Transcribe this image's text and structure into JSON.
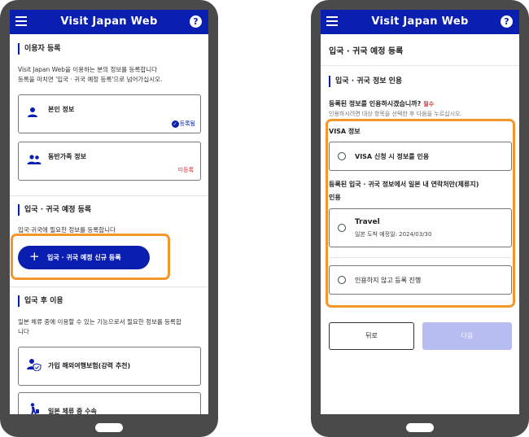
{
  "app": {
    "title": "Visit Japan Web",
    "help": "?"
  },
  "left": {
    "user_section": {
      "title": "이용자 등록",
      "desc_line1": "Visit Japan Web을 이용하는 분의 정보를 등록합니다",
      "desc_line2": "등록을 마치면 '입국 · 귀국 예정 등록'으로 넘어가십시오.",
      "card_self": {
        "label": "본인 정보",
        "status": "등록됨"
      },
      "card_family": {
        "label": "동반가족 정보",
        "status": "미등록"
      }
    },
    "entry_section": {
      "title": "입국 · 귀국 예정 등록",
      "desc": "입국·귀국에 필요한 정보를 등록합니다",
      "button": "입국 · 귀국 예정 신규 등록",
      "button_icon": "+"
    },
    "after_section": {
      "title": "입국 후 이용",
      "desc_line1": "일본 체류 중에 이용할 수 있는 기능으로서 필요한 정보를 등록합",
      "desc_line2": "니다",
      "card_insurance": {
        "label": "가입 해외여행보험(강력 추천)"
      },
      "card_stay": {
        "label": "일본 체류 중 수속"
      }
    }
  },
  "right": {
    "page_title": "입국 · 귀국 예정 등록",
    "section_title": "입국 · 귀국 정보 인용",
    "question": "등록된 정보를 인용하시겠습니까?",
    "required": "필수",
    "question_sub": "인용하시려면 대상 항목을 선택한 후 다음을 누르십시오.",
    "visa_heading": "VISA 정보",
    "visa_option": "VISA 신청 시 정보를 인용",
    "contact_heading_line1": "등록된 입국 · 귀국 정보에서 일본 내 연락처만(체류지)",
    "contact_heading_line2": "인용",
    "travel_option": {
      "title": "Travel",
      "sub": "일본 도착 예정일: 2024/03/30"
    },
    "no_cite_option": "인용하지 않고 등록 진행",
    "back_button": "뒤로",
    "next_button": "다음"
  },
  "colors": {
    "primary": "#0a1fb0",
    "highlight": "#f3962c",
    "required": "#d83030",
    "disabled": "#b7bdf0"
  }
}
